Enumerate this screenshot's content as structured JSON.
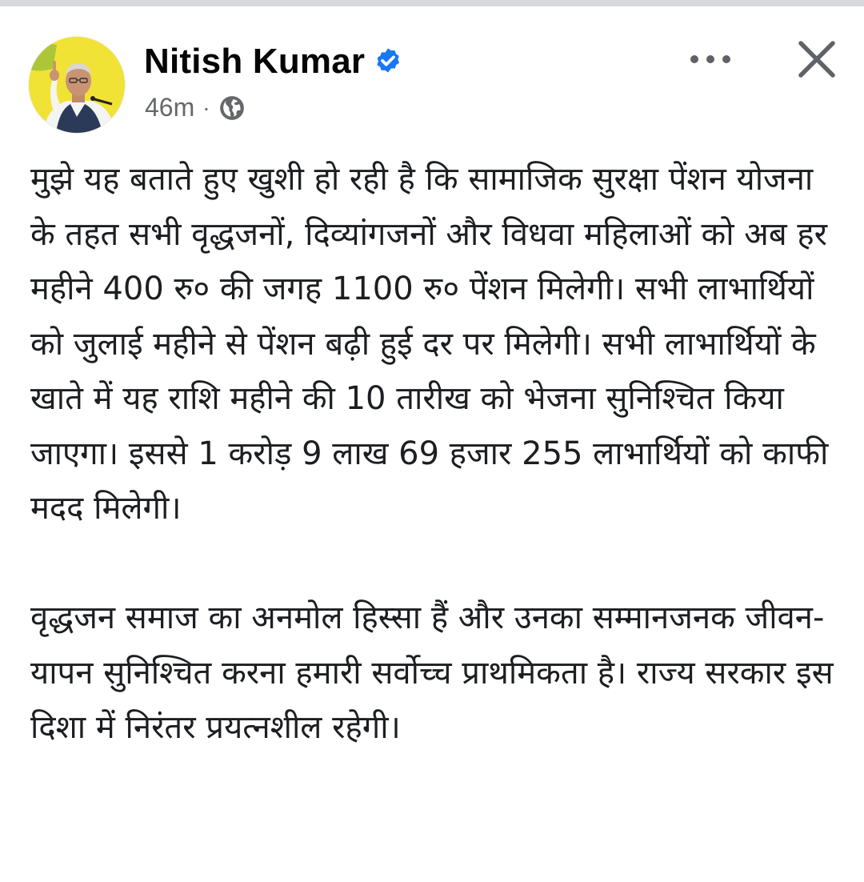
{
  "post": {
    "author_name": "Nitish Kumar",
    "timestamp": "46m",
    "separator": "·",
    "privacy_icon": "globe-icon",
    "verified_icon": "verified-badge-icon",
    "more_icon": "more-options-icon",
    "close_icon": "close-icon",
    "paragraphs": [
      "मुझे यह बताते हुए खुशी हो रही है कि सामाजिक सुरक्षा पेंशन योजना के तहत सभी वृद्धजनों, दिव्यांगजनों और विधवा महिलाओं को अब हर महीने 400 रु० की जगह 1100 रु० पेंशन मिलेगी। सभी लाभार्थियों को जुलाई महीने से पेंशन बढ़ी हुई दर पर मिलेगी। सभी लाभार्थियों के खाते में यह राशि महीने की 10 तारीख को भेजना सुनिश्चित किया जाएगा। इससे 1 करोड़ 9 लाख 69 हजार 255 लाभार्थियों को काफी मदद मिलेगी।",
      "वृद्धजन समाज का अनमोल हिस्सा हैं और उनका सम्मानजनक जीवन-यापन सुनिश्चित करना हमारी सर्वोच्च प्राथमिकता है। राज्य सरकार इस दिशा में निरंतर प्रयत्नशील रहेगी।"
    ]
  },
  "colors": {
    "verified_blue": "#1877f2",
    "meta_gray": "#65676b",
    "text": "#1c1e21",
    "avatar_yellow": "#f3e33a"
  }
}
